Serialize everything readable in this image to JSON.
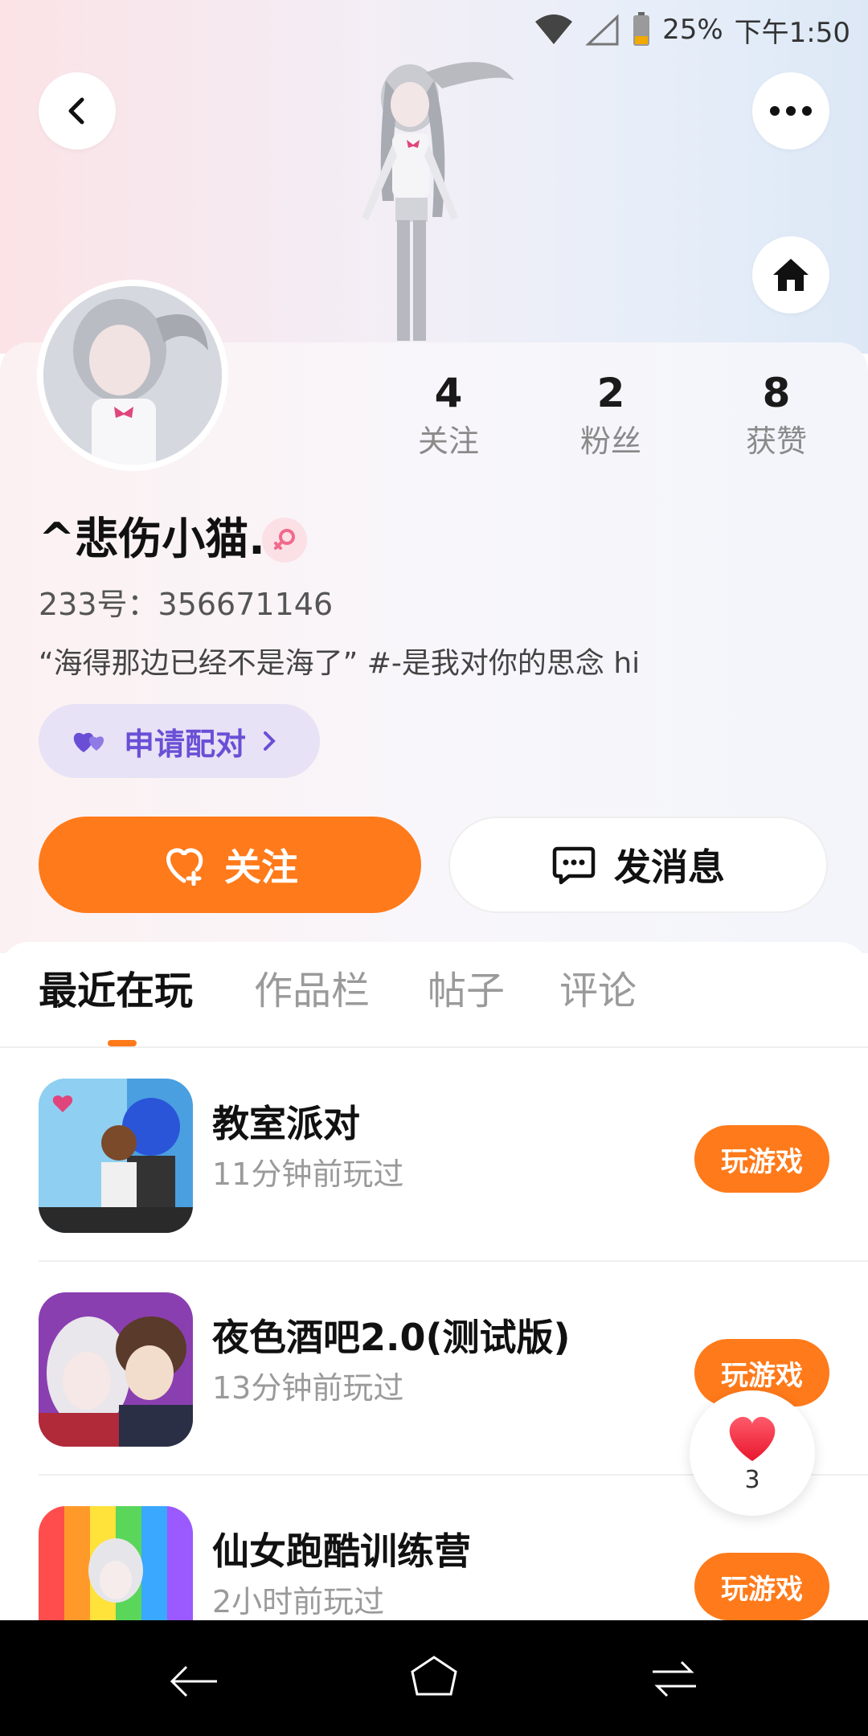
{
  "status": {
    "battery": "25%",
    "time": "下午1:50"
  },
  "stats": [
    {
      "value": "4",
      "label": "关注"
    },
    {
      "value": "2",
      "label": "粉丝"
    },
    {
      "value": "8",
      "label": "获赞"
    }
  ],
  "profile": {
    "nickname": "^悲伤小猫.",
    "uid": "233号：356671146",
    "bio": "“海得那边已经不是海了” #-是我对你的思念 hi",
    "pair_label": "申请配对"
  },
  "actions": {
    "follow": "关注",
    "message": "发消息"
  },
  "tabs": [
    "最近在玩",
    "作品栏",
    "帖子",
    "评论"
  ],
  "games": [
    {
      "title": "教室派对",
      "time": "11分钟前玩过",
      "button": "玩游戏"
    },
    {
      "title": "夜色酒吧2.0(测试版)",
      "time": "13分钟前玩过",
      "button": "玩游戏"
    },
    {
      "title": "仙女跑酷训练营",
      "time": "2小时前玩过",
      "button": "玩游戏"
    }
  ],
  "like_float": {
    "count": "3"
  },
  "colors": {
    "accent": "#ff7a1a",
    "pair": "#6a4fd6"
  }
}
